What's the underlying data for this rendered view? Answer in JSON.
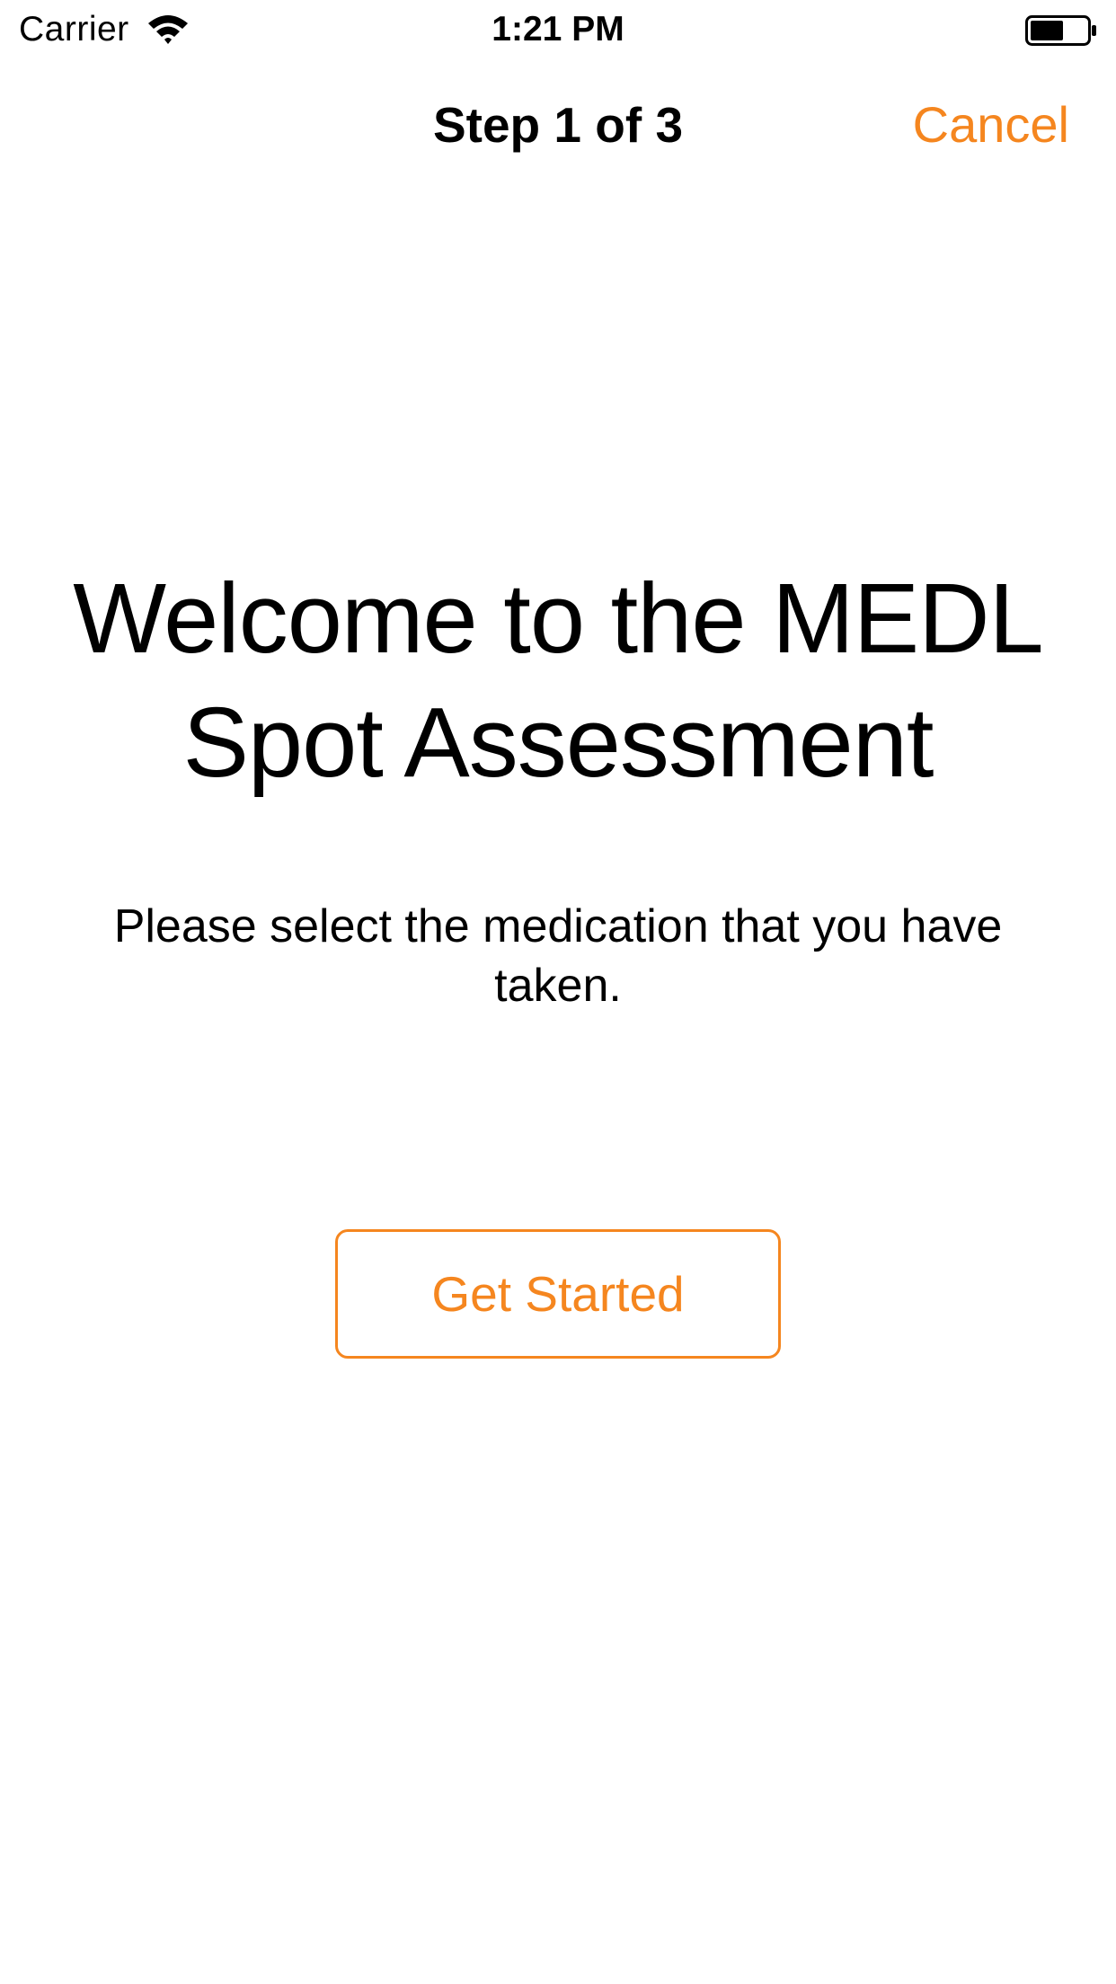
{
  "status_bar": {
    "carrier": "Carrier",
    "time": "1:21 PM",
    "wifi_icon": "wifi-icon",
    "battery_icon": "battery-icon"
  },
  "nav": {
    "title": "Step 1 of 3",
    "cancel_label": "Cancel"
  },
  "content": {
    "welcome_title": "Welcome to the MEDL Spot Assessment",
    "instruction": "Please select the medication that you have taken.",
    "get_started_label": "Get Started"
  },
  "colors": {
    "accent": "#F5861F",
    "text": "#000000",
    "background": "#FFFFFF"
  }
}
